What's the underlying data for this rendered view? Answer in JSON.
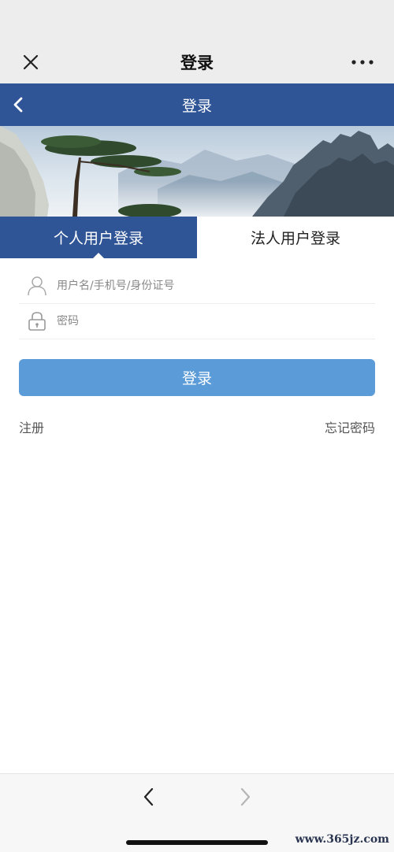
{
  "wechat_bar": {
    "title": "登录",
    "close_icon": "close-icon",
    "more_icon": "more-dots-icon",
    "background": "#ededed"
  },
  "header": {
    "title": "登录",
    "back_icon": "chevron-left-icon",
    "background": "#2f5596"
  },
  "tabs": [
    {
      "label": "个人用户登录",
      "active": true
    },
    {
      "label": "法人用户登录",
      "active": false
    }
  ],
  "form": {
    "username_placeholder": "用户名/手机号/身份证号",
    "username_value": "",
    "username_icon": "user-icon",
    "password_placeholder": "密码",
    "password_value": "",
    "password_icon": "lock-icon",
    "submit_label": "登录",
    "submit_color": "#5b9bd8"
  },
  "links": {
    "register": "注册",
    "forgot_password": "忘记密码"
  },
  "bottom_nav": {
    "back_icon": "chevron-left-icon",
    "forward_icon": "chevron-right-icon"
  },
  "watermark": "www.365jz.com"
}
